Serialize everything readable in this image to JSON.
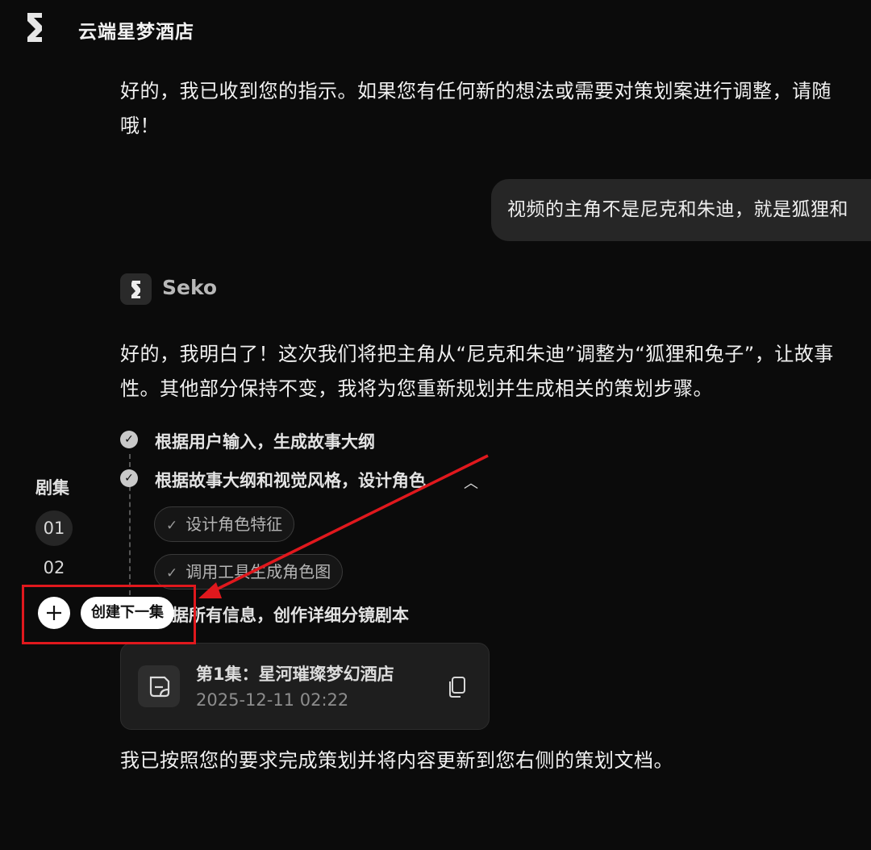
{
  "header": {
    "app_title": "云端星梦酒店"
  },
  "messages": {
    "assistant_1_line1": "好的，我已收到您的指示。如果您有任何新的想法或需要对策划案进行调整，请随",
    "assistant_1_line2": "哦！",
    "user_1": "视频的主角不是尼克和朱迪，就是狐狸和",
    "assistant_name": "Seko",
    "assistant_2_line1": "好的，我明白了！这次我们将把主角从“尼克和朱迪”调整为“狐狸和兔子”，让故事",
    "assistant_2_line2": "性。其他部分保持不变，我将为您重新规划并生成相关的策划步骤。",
    "assistant_3": "我已按照您的要求完成策划并将内容更新到您右侧的策划文档。"
  },
  "steps": [
    {
      "label": "根据用户输入，生成故事大纲"
    },
    {
      "label": "根据故事大纲和视觉风格，设计角色"
    },
    {
      "label": "根据所有信息，创作详细分镜剧本"
    }
  ],
  "subtasks": [
    {
      "label": "设计角色特征"
    },
    {
      "label": "调用工具生成角色图"
    }
  ],
  "doc_card": {
    "title": "第1集：星河璀璨梦幻酒店",
    "date": "2025-12-11 02:22"
  },
  "episodes": {
    "label": "剧集",
    "items": [
      "01",
      "02"
    ],
    "active": "01",
    "create_tooltip": "创建下一集"
  },
  "colors": {
    "background": "#0b0b0b",
    "annotation_red": "#e0181d",
    "bubble": "#262626"
  },
  "icons": [
    "app-logo-icon",
    "seko-logo-icon",
    "check-icon",
    "chevron-up-icon",
    "document-icon",
    "copy-icon",
    "plus-icon"
  ]
}
